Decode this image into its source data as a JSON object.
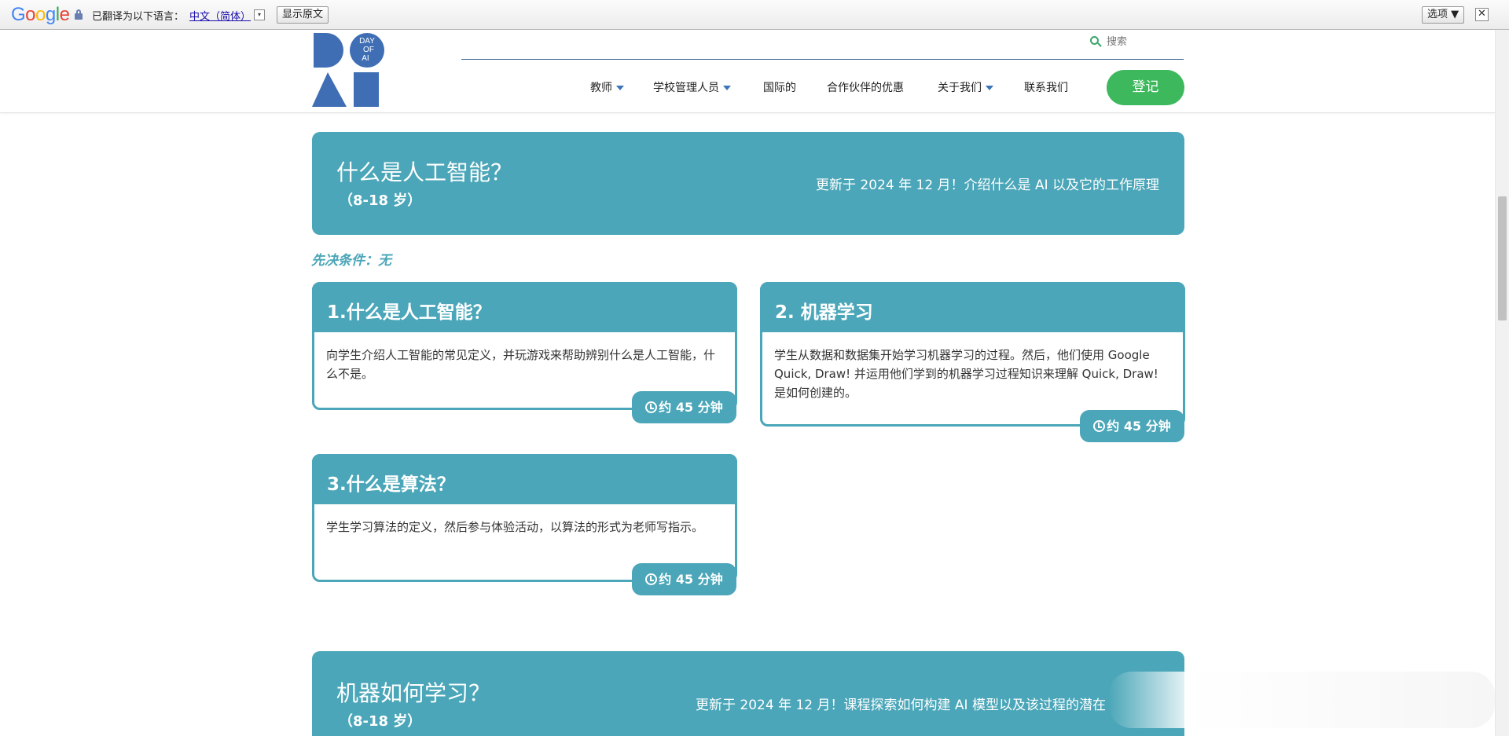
{
  "translate_bar": {
    "logo": "Google",
    "message": "已翻译为以下语言：",
    "language": "中文（简体）",
    "dropdown": "▾",
    "show_original": "显示原文",
    "options": "选项 ▼",
    "close": "✕"
  },
  "header": {
    "logo_text": [
      "DAY",
      "OF",
      "AI"
    ],
    "search_placeholder": "搜索",
    "nav": [
      {
        "label": "教师",
        "dropdown": true
      },
      {
        "label": "学校管理人员",
        "dropdown": true
      },
      {
        "label": "国际的",
        "dropdown": false
      },
      {
        "label": "合作伙伴的优惠",
        "dropdown": false
      },
      {
        "label": "关于我们",
        "dropdown": true
      },
      {
        "label": "联系我们",
        "dropdown": false
      }
    ],
    "login": "登记"
  },
  "section1": {
    "title": "什么是人工智能？",
    "age": "（8-18 岁）",
    "description": "更新于 2024 年 12 月！介绍什么是 AI 以及它的工作原理",
    "prerequisite": "先决条件：无",
    "cards": [
      {
        "title": "1.什么是人工智能？",
        "body": "向学生介绍人工智能的常见定义，并玩游戏来帮助辨别什么是人工智能，什么不是。",
        "duration": "约 45 分钟"
      },
      {
        "title": "2. 机器学习",
        "body": "学生从数据和数据集开始学习机器学习的过程。然后，他们使用 Google Quick, Draw! 并运用他们学到的机器学习过程知识来理解 Quick, Draw! 是如何创建的。",
        "duration": "约 45 分钟"
      },
      {
        "title": "3.什么是算法？",
        "body": "学生学习算法的定义，然后参与体验活动，以算法的形式为老师写指示。",
        "duration": "约 45 分钟"
      }
    ]
  },
  "section2": {
    "title": "机器如何学习？",
    "age": "（8-18 岁）",
    "description": "更新于 2024 年 12 月！课程探索如何构建 AI 模型以及该过程的潜在"
  },
  "colors": {
    "teal": "#4aa6b8",
    "login_green": "#3db85d",
    "logo_blue": "#3f6eb4",
    "nav_caret": "#3b74b9"
  }
}
